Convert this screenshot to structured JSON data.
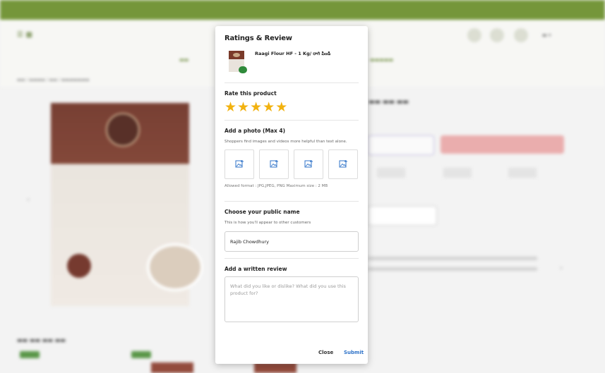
{
  "modal": {
    "title": "Ratings & Review",
    "product_name": "Raagi Flour HF - 1 Kg/ రాగి పిండి",
    "rate_label": "Rate this product",
    "rating": 5,
    "stars": [
      "★",
      "★",
      "★",
      "★",
      "★"
    ],
    "photo_label": "Add a photo (Max 4)",
    "photo_help": "Shoppers find images and videos more helpful than text alone.",
    "photo_slots": 4,
    "format_note": "Allowed format : JPG,JPEG, PNG Maximum size : 2 MB",
    "name_label": "Choose your public name",
    "name_help": "This is how you'll appear to other customers",
    "name_value": "Rajib Chowdhury",
    "review_label": "Add a written review",
    "review_placeholder": "What did you like or dislike? What did you use this product for?",
    "close_label": "Close",
    "submit_label": "Submit"
  },
  "colors": {
    "star": "#f2b20f",
    "submit": "#2f73c9",
    "topbar": "#6a8e2a",
    "photo_icon": "#2f73c9"
  },
  "icons": {
    "photo_slot": "add-image-icon"
  }
}
